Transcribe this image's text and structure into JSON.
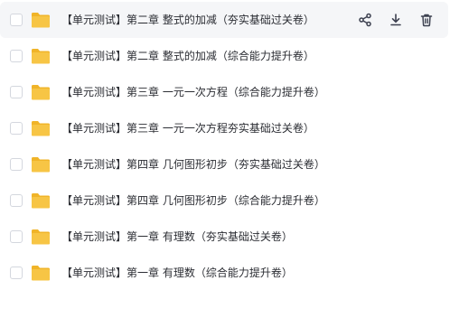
{
  "files": [
    {
      "name": "【单元测试】第二章 整式的加减（夯实基础过关卷）"
    },
    {
      "name": "【单元测试】第二章 整式的加减（综合能力提升卷）"
    },
    {
      "name": "【单元测试】第三章 一元一次方程（综合能力提升卷）"
    },
    {
      "name": "【单元测试】第三章 一元一次方程夯实基础过关卷）"
    },
    {
      "name": "【单元测试】第四章 几何图形初步（夯实基础过关卷）"
    },
    {
      "name": "【单元测试】第四章 几何图形初步（综合能力提升卷）"
    },
    {
      "name": "【单元测试】第一章 有理数（夯实基础过关卷）"
    },
    {
      "name": "【单元测试】第一章 有理数（综合能力提升卷）"
    }
  ],
  "row_actions": {
    "share_icon": "share-icon",
    "download_icon": "download-icon",
    "delete_icon": "trash-icon"
  },
  "colors": {
    "folder": "#f7c545",
    "folder_tab": "#f0b429",
    "icon": "#3d4150",
    "text": "#2b2d33",
    "hover_bg": "#f5f6f8"
  }
}
